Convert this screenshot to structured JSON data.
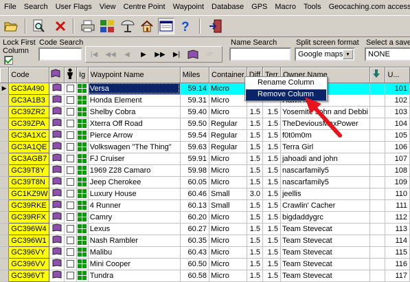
{
  "menu": [
    "File",
    "Search",
    "User Flags",
    "View",
    "Centre Point",
    "Waypoint",
    "Database",
    "GPS",
    "Macro",
    "Tools",
    "Geocaching.com access"
  ],
  "filters": {
    "lock_first_label": "Lock First",
    "column_label": "Column",
    "lock_first_checked": true,
    "code_search_label": "Code Search",
    "code_search_value": "",
    "name_search_label": "Name Search",
    "name_search_value": "",
    "split_label": "Split screen format",
    "split_value": "Google maps",
    "saved_label": "Select a saved",
    "saved_value": "NONE"
  },
  "columns": {
    "code": "Code",
    "ig": "Ig",
    "name": "Waypoint Name",
    "miles": "Miles",
    "container": "Container",
    "diff": "Diff",
    "terr": "Terr",
    "owner": "Owner Name",
    "u": "U..."
  },
  "rows": [
    {
      "code": "GC3A490",
      "name": "Versa",
      "miles": "59.14",
      "container": "Micro",
      "diff": "",
      "terr": "",
      "owner": "",
      "u": "101"
    },
    {
      "code": "GC3A1B3",
      "name": "Honda Element",
      "miles": "59.31",
      "container": "Micro",
      "diff": "",
      "terr": "",
      "owner": "Hawk kids",
      "u": "102"
    },
    {
      "code": "GC39ZR2",
      "name": "Shelby Cobra",
      "miles": "59.40",
      "container": "Micro",
      "diff": "1.5",
      "terr": "1.5",
      "owner": "Yosemite John and Debbi",
      "u": "103"
    },
    {
      "code": "GC39ZPA",
      "name": "Xterra Off Road",
      "miles": "59.50",
      "container": "Regular",
      "diff": "1.5",
      "terr": "1.5",
      "owner": "TheDeviousMaxPower",
      "u": "104"
    },
    {
      "code": "GC3A1XC",
      "name": "Pierce Arrow",
      "miles": "59.54",
      "container": "Regular",
      "diff": "1.5",
      "terr": "1.5",
      "owner": "f0t0m0m",
      "u": "105"
    },
    {
      "code": "GC3A1QE",
      "name": "Volkswagen \"The Thing\"",
      "miles": "59.63",
      "container": "Regular",
      "diff": "1.5",
      "terr": "1.5",
      "owner": "Terra Girl",
      "u": "106"
    },
    {
      "code": "GC3AGB7",
      "name": "FJ Cruiser",
      "miles": "59.91",
      "container": "Micro",
      "diff": "1.5",
      "terr": "1.5",
      "owner": "jahoadi and john",
      "u": "107"
    },
    {
      "code": "GC39T8Y",
      "name": "1969 Z28 Camaro",
      "miles": "59.98",
      "container": "Micro",
      "diff": "1.5",
      "terr": "1.5",
      "owner": "nascarfamily5",
      "u": "108"
    },
    {
      "code": "GC39T8N",
      "name": "Jeep Cherokee",
      "miles": "60.05",
      "container": "Micro",
      "diff": "1.5",
      "terr": "1.5",
      "owner": "nascarfamily5",
      "u": "109"
    },
    {
      "code": "GC1KZ9W",
      "name": "Luxury House",
      "miles": "60.46",
      "container": "Small",
      "diff": "3.0",
      "terr": "1.5",
      "owner": "jeellis",
      "u": "110"
    },
    {
      "code": "GC39RKE",
      "name": "4 Runner",
      "miles": "60.13",
      "container": "Small",
      "diff": "1.5",
      "terr": "1.5",
      "owner": "Crawlin' Cacher",
      "u": "111"
    },
    {
      "code": "GC39RFX",
      "name": "Camry",
      "miles": "60.20",
      "container": "Micro",
      "diff": "1.5",
      "terr": "1.5",
      "owner": "bigdaddygrc",
      "u": "112"
    },
    {
      "code": "GC396W4",
      "name": "Lexus",
      "miles": "60.27",
      "container": "Micro",
      "diff": "1.5",
      "terr": "1.5",
      "owner": "Team Stevecat",
      "u": "113"
    },
    {
      "code": "GC396W1",
      "name": "Nash Rambler",
      "miles": "60.35",
      "container": "Micro",
      "diff": "1.5",
      "terr": "1.5",
      "owner": "Team Stevecat",
      "u": "114"
    },
    {
      "code": "GC396VY",
      "name": "Malibu",
      "miles": "60.43",
      "container": "Micro",
      "diff": "1.5",
      "terr": "1.5",
      "owner": "Team Stevecat",
      "u": "115"
    },
    {
      "code": "GC396VV",
      "name": "Mini Cooper",
      "miles": "60.50",
      "container": "Micro",
      "diff": "1.5",
      "terr": "1.5",
      "owner": "Team Stevecat",
      "u": "116"
    },
    {
      "code": "GC396VT",
      "name": "Tundra",
      "miles": "60.58",
      "container": "Micro",
      "diff": "1.5",
      "terr": "1.5",
      "owner": "Team Stevecat",
      "u": "117"
    }
  ],
  "context_menu": [
    "Rename Column",
    "Remove Column"
  ],
  "colors": {
    "code_bg": "#ffff00",
    "selected_bg": "#00ffff",
    "highlight": "#0a246a",
    "arrow": "#e8131b"
  }
}
